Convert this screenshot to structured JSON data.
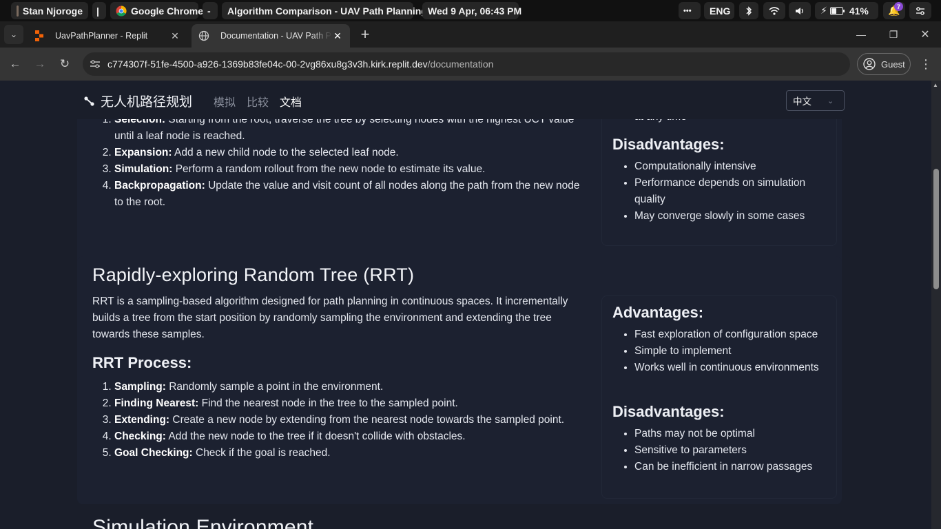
{
  "os_bar": {
    "user": "Stan Njoroge",
    "separator": "|",
    "app": "Google Chrome",
    "dash": "-",
    "window_title": "Algorithm Comparison - UAV Path Planning...",
    "datetime": "Wed 9 Apr, 06:43 PM",
    "more": "•••",
    "keyboard_lang": "ENG",
    "battery": "41%",
    "notifications_count": "7"
  },
  "tabs": [
    {
      "label": "UavPathPlanner - Replit",
      "close": "✕"
    },
    {
      "label": "Documentation - UAV Path Planner",
      "close": "✕"
    }
  ],
  "tab_new": "+",
  "window_controls": {
    "minimize": "—",
    "restore": "❐",
    "close": "✕"
  },
  "address": {
    "url_host": "c774307f-51fe-4500-a926-1369b83fe04c-00-2vg86xu8g3v3h.kirk.replit.dev",
    "url_path": "/documentation",
    "profile": "Guest"
  },
  "site_nav": {
    "brand": "无人机路径规划",
    "links": [
      "模拟",
      "比较",
      "文档"
    ],
    "lang_select": "中文"
  },
  "mcts": {
    "steps": [
      {
        "term": "Selection:",
        "text": " Starting from the root, traverse the tree by selecting nodes with the highest UCT value until a leaf node is reached."
      },
      {
        "term": "Expansion:",
        "text": " Add a new child node to the selected leaf node."
      },
      {
        "term": "Simulation:",
        "text": " Perform a random rollout from the new node to estimate its value."
      },
      {
        "term": "Backpropagation:",
        "text": " Update the value and visit count of all nodes along the path from the new node to the root."
      }
    ],
    "adv_tail": "at any time",
    "disadv_heading": "Disadvantages:",
    "disadvantages": [
      "Computationally intensive",
      "Performance depends on simulation quality",
      "May converge slowly in some cases"
    ]
  },
  "rrt": {
    "heading": "Rapidly-exploring Random Tree (RRT)",
    "description": "RRT is a sampling-based algorithm designed for path planning in continuous spaces. It incrementally builds a tree from the start position by randomly sampling the environment and extending the tree towards these samples.",
    "process_heading": "RRT Process:",
    "steps": [
      {
        "term": "Sampling:",
        "text": " Randomly sample a point in the environment."
      },
      {
        "term": "Finding Nearest:",
        "text": " Find the nearest node in the tree to the sampled point."
      },
      {
        "term": "Extending:",
        "text": " Create a new node by extending from the nearest node towards the sampled point."
      },
      {
        "term": "Checking:",
        "text": " Add the new node to the tree if it doesn't collide with obstacles."
      },
      {
        "term": "Goal Checking:",
        "text": " Check if the goal is reached."
      }
    ],
    "adv_heading": "Advantages:",
    "advantages": [
      "Fast exploration of configuration space",
      "Simple to implement",
      "Works well in continuous environments"
    ],
    "disadv_heading": "Disadvantages:",
    "disadvantages": [
      "Paths may not be optimal",
      "Sensitive to parameters",
      "Can be inefficient in narrow passages"
    ]
  },
  "next_section": {
    "heading": "Simulation Environment"
  }
}
